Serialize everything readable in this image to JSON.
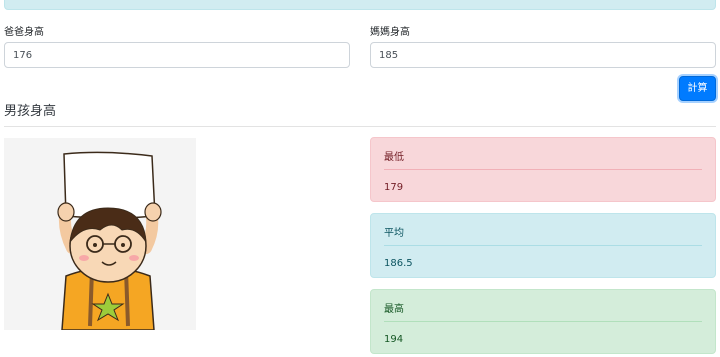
{
  "form": {
    "dad_label": "爸爸身高",
    "dad_value": "176",
    "mom_label": "媽媽身高",
    "mom_value": "185",
    "calc_button": "計算"
  },
  "section": {
    "title": "男孩身高"
  },
  "image": {
    "icon": "boy-holding-sign-illustration"
  },
  "results": {
    "low": {
      "label": "最低",
      "value": "179"
    },
    "avg": {
      "label": "平均",
      "value": "186.5"
    },
    "high": {
      "label": "最高",
      "value": "194"
    }
  },
  "colors": {
    "primary": "#007bff",
    "danger_bg": "#f8d7da",
    "info_bg": "#d1ecf1",
    "success_bg": "#d4edda"
  }
}
